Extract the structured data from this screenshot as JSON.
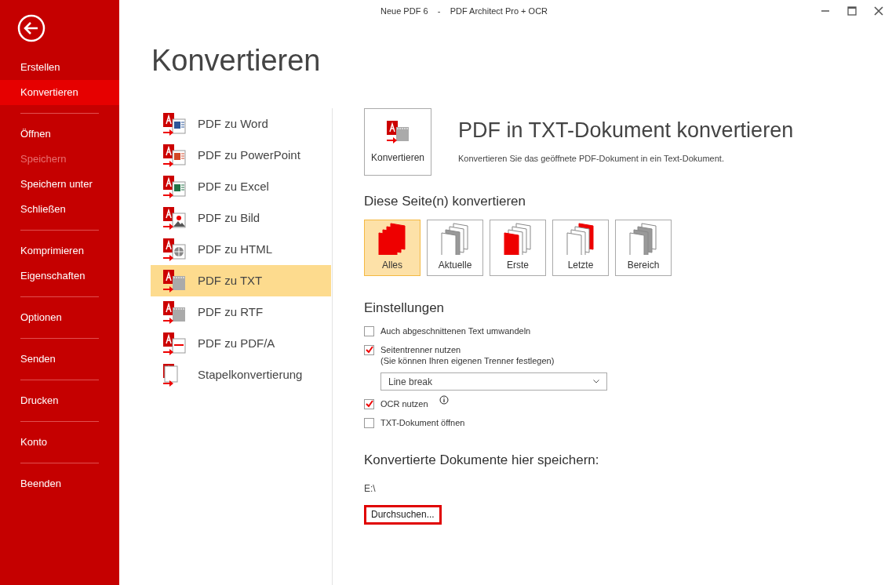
{
  "window": {
    "title": "Neue PDF 6    -    PDF Architect Pro + OCR"
  },
  "sidebar": {
    "groups": [
      [
        {
          "label": "Erstellen",
          "selected": false,
          "disabled": false
        },
        {
          "label": "Konvertieren",
          "selected": true,
          "disabled": false
        }
      ],
      [
        {
          "label": "Öffnen",
          "selected": false,
          "disabled": false
        },
        {
          "label": "Speichern",
          "selected": false,
          "disabled": true
        },
        {
          "label": "Speichern unter",
          "selected": false,
          "disabled": false
        },
        {
          "label": "Schließen",
          "selected": false,
          "disabled": false
        }
      ],
      [
        {
          "label": "Komprimieren",
          "selected": false,
          "disabled": false
        },
        {
          "label": "Eigenschaften",
          "selected": false,
          "disabled": false
        }
      ],
      [
        {
          "label": "Optionen",
          "selected": false,
          "disabled": false
        }
      ],
      [
        {
          "label": "Senden",
          "selected": false,
          "disabled": false
        }
      ],
      [
        {
          "label": "Drucken",
          "selected": false,
          "disabled": false
        }
      ],
      [
        {
          "label": "Konto",
          "selected": false,
          "disabled": false
        }
      ],
      [
        {
          "label": "Beenden",
          "selected": false,
          "disabled": false
        }
      ]
    ]
  },
  "page_title": "Konvertieren",
  "conversions": [
    {
      "label": "PDF zu Word",
      "kind": "word",
      "selected": false
    },
    {
      "label": "PDF zu PowerPoint",
      "kind": "powerpoint",
      "selected": false
    },
    {
      "label": "PDF zu Excel",
      "kind": "excel",
      "selected": false
    },
    {
      "label": "PDF zu Bild",
      "kind": "image",
      "selected": false
    },
    {
      "label": "PDF zu HTML",
      "kind": "html",
      "selected": false
    },
    {
      "label": "PDF zu TXT",
      "kind": "txt",
      "selected": true
    },
    {
      "label": "PDF zu RTF",
      "kind": "rtf",
      "selected": false
    },
    {
      "label": "PDF zu PDF/A",
      "kind": "pdfa",
      "selected": false
    },
    {
      "label": "Stapelkonvertierung",
      "kind": "batch",
      "selected": false
    }
  ],
  "detail": {
    "convert_button": "Konvertieren",
    "heading": "PDF in TXT-Dokument konvertieren",
    "description": "Konvertieren Sie das geöffnete PDF-Dokument in ein Text-Dokument."
  },
  "pages_section": {
    "heading": "Diese Seite(n) konvertieren",
    "options": [
      {
        "label": "Alles",
        "kind": "all",
        "selected": true
      },
      {
        "label": "Aktuelle",
        "kind": "current",
        "selected": false
      },
      {
        "label": "Erste",
        "kind": "first",
        "selected": false
      },
      {
        "label": "Letzte",
        "kind": "last",
        "selected": false
      },
      {
        "label": "Bereich",
        "kind": "range",
        "selected": false
      }
    ]
  },
  "settings": {
    "heading": "Einstellungen",
    "options": [
      {
        "label": "Auch abgeschnittenen Text umwandeln",
        "checked": false
      },
      {
        "label": "Seitentrenner nutzen",
        "hint": "(Sie können Ihren eigenen Trenner festlegen)",
        "checked": true,
        "dropdown": "Line break"
      },
      {
        "label": "OCR nutzen",
        "checked": true,
        "info": true
      },
      {
        "label": "TXT-Dokument öffnen",
        "checked": false
      }
    ]
  },
  "save_section": {
    "heading": "Konvertierte Dokumente hier speichern:",
    "path": "E:\\",
    "browse_button": "Durchsuchen..."
  }
}
